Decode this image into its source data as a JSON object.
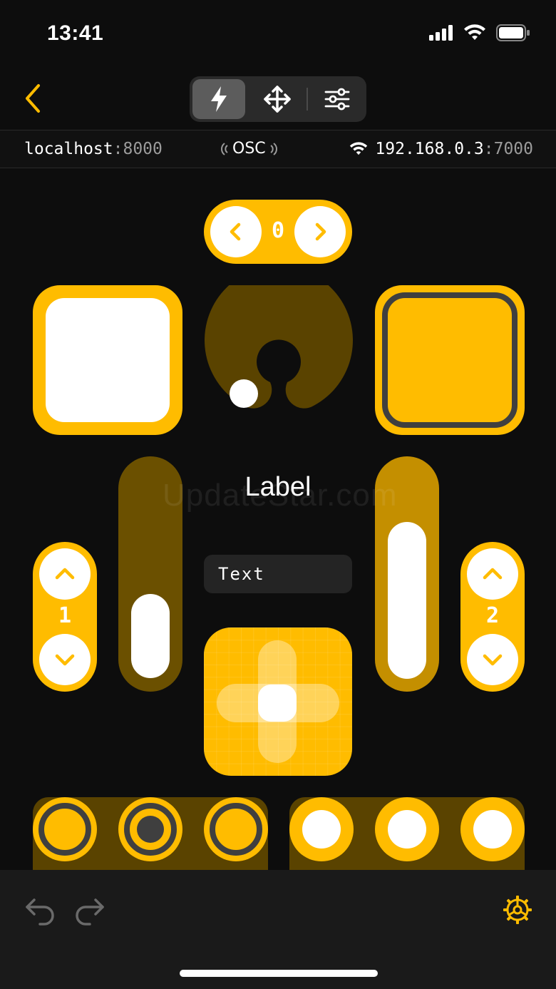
{
  "status_bar": {
    "time": "13:41",
    "icons": [
      "cellular-signal-icon",
      "wifi-icon",
      "battery-icon"
    ]
  },
  "nav": {
    "back_icon": "chevron-left-icon",
    "segments": [
      {
        "icon": "bolt-icon",
        "selected": true
      },
      {
        "icon": "move-arrows-icon",
        "selected": false
      },
      {
        "icon": "sliders-icon",
        "selected": false
      }
    ]
  },
  "connection": {
    "local_host": "localhost",
    "local_port": ":8000",
    "protocol": "OSC",
    "remote_host": "192.168.0.3",
    "remote_port": ":7000"
  },
  "controls": {
    "stepper_horizontal_value": "0",
    "label_text": "Label",
    "text_field_value": "Text",
    "stepper_vertical_1_value": "1",
    "stepper_vertical_2_value": "2",
    "slider_1_level": 0.36,
    "slider_2_level": 0.7,
    "radio_group_1": {
      "options": 3,
      "selected_index": 1
    },
    "radio_group_2": {
      "options": 3,
      "selected_index": -1
    }
  },
  "watermark": "UpdateStar.com",
  "toolbar": {
    "undo_icon": "undo-icon",
    "redo_icon": "redo-icon",
    "settings_icon": "gear-icon"
  },
  "colors": {
    "accent": "#ffbc00",
    "background": "#0d0d0d",
    "dim_text": "#9b9b9b"
  }
}
